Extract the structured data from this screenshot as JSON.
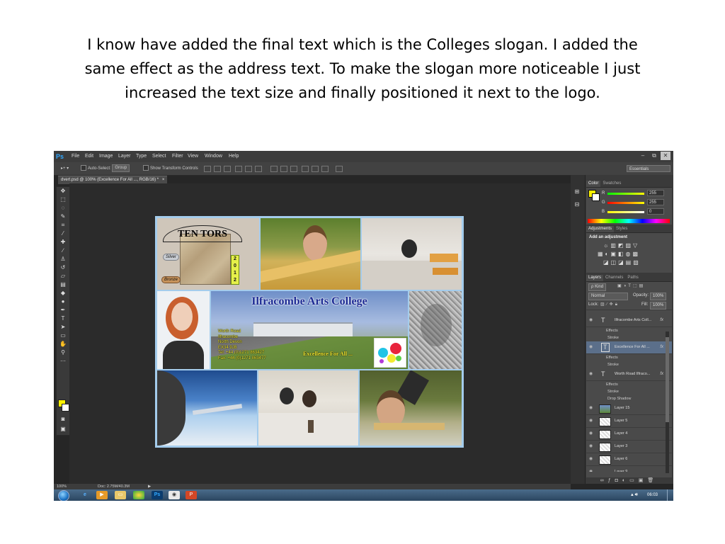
{
  "caption": {
    "line1": "I know have added the final text which is the Colleges slogan. I added the",
    "line2": "same effect as the address text. To make the slogan more noticeable I just",
    "line3": "increased the text size and finally positioned it next to the logo."
  },
  "app": {
    "logo": "Ps",
    "menus": [
      "File",
      "Edit",
      "Image",
      "Layer",
      "Type",
      "Select",
      "Filter",
      "View",
      "Window",
      "Help"
    ],
    "window_buttons": [
      "–",
      "⧉",
      "✕"
    ]
  },
  "options_bar": {
    "move_tool": "▸+ ▾",
    "auto_select_label": "Auto-Select:",
    "auto_select_value": "Group",
    "show_transform_label": "Show Transform Controls",
    "workspace": "Essentials"
  },
  "document": {
    "tab_title": "dvert.psd @ 100% (Excellence For All ..., RGB/16) *",
    "tab_close": "×",
    "zoom": "100%",
    "doc_info": "Doc: 2.75M/40.3M"
  },
  "poster": {
    "ten_tors": "TEN TORS",
    "silver": "Silver",
    "bronze": "Bronze",
    "year": [
      "2",
      "0",
      "1",
      "2"
    ],
    "title": "Ilfracombe Arts College",
    "address": [
      "Worth Road",
      "Ilfracombe",
      "North Devon",
      "EX34 9JB",
      "Tel: +44 (0)1271 863427",
      "Fax: +44 (0)1271 863477"
    ],
    "slogan": "Excellence For All ..."
  },
  "color_panel": {
    "tabs": [
      "Color",
      "Swatches"
    ],
    "channels": [
      {
        "label": "R",
        "value": "255",
        "color": "#ff3b3b"
      },
      {
        "label": "G",
        "value": "255",
        "color": "#3bdc3b"
      },
      {
        "label": "B",
        "value": "0",
        "color": "#3b6bff"
      }
    ]
  },
  "adjustments_panel": {
    "tabs": [
      "Adjustments",
      "Styles"
    ],
    "heading": "Add an adjustment"
  },
  "layers_panel": {
    "tabs": [
      "Layers",
      "Channels",
      "Paths"
    ],
    "kind": "ρ Kind",
    "blend_mode": "Normal",
    "opacity_label": "Opacity:",
    "opacity_value": "100%",
    "lock_label": "Lock:",
    "fill_label": "Fill:",
    "fill_value": "100%",
    "effects_label": "Effects",
    "stroke_label": "Stroke",
    "drop_shadow_label": "Drop Shadow",
    "fx": "fx",
    "text_layers": [
      "Ilfracombe Arts Coll...",
      "Excellence For All ...",
      "Worth Road Ilfraco..."
    ],
    "image_layers": [
      "Layer 15",
      "Layer 5",
      "Layer 4",
      "Layer 3",
      "Layer 6",
      "Layer 9"
    ]
  },
  "taskbar": {
    "clock": "06:03"
  }
}
